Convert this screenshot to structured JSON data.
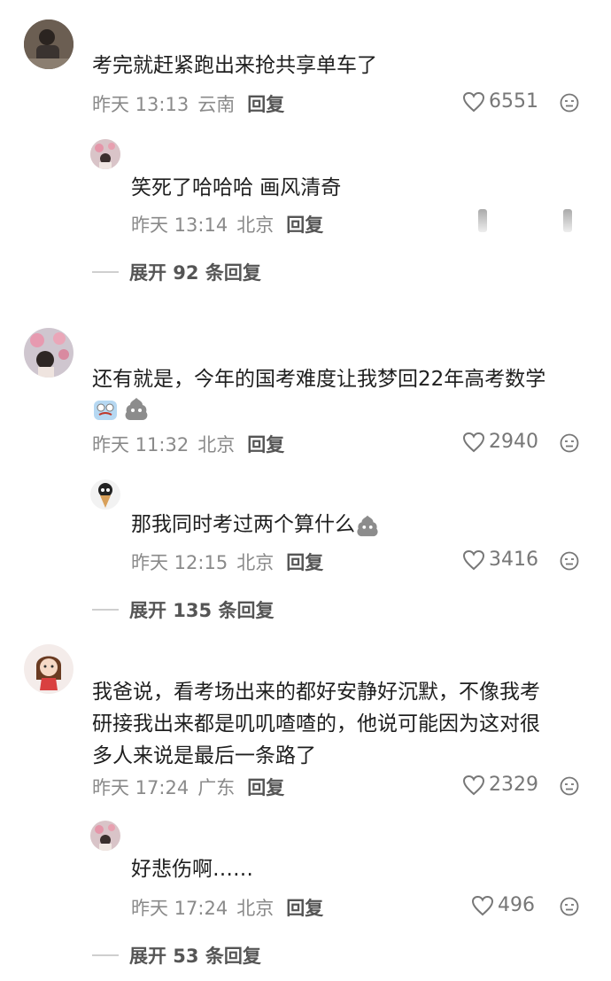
{
  "comments": [
    {
      "text": "考完就赶紧跑出来抢共享单车了",
      "time": "昨天 13:13",
      "location": "云南",
      "reply_label": "回复",
      "likes": "6551",
      "reply": {
        "text": "笑死了哈哈哈 画风清奇",
        "time": "昨天 13:14",
        "location": "北京",
        "reply_label": "回复",
        "likes": ""
      },
      "expand": "展开 92 条回复"
    },
    {
      "text": "还有就是，今年的国考难度让我梦回22年高考数学",
      "time": "昨天 11:32",
      "location": "北京",
      "reply_label": "回复",
      "likes": "2940",
      "reply": {
        "text": "那我同时考过两个算什么",
        "time": "昨天 12:15",
        "location": "北京",
        "reply_label": "回复",
        "likes": "3416"
      },
      "expand": "展开 135 条回复"
    },
    {
      "text_lines": [
        "我爸说，看考场出来的都好安静好沉默，不像我考",
        "研接我出来都是叽叽喳喳的，他说可能因为这对很",
        "多人来说是最后一条路了"
      ],
      "time": "昨天 17:24",
      "location": "广东",
      "reply_label": "回复",
      "likes": "2329",
      "reply": {
        "text": "好悲伤啊……",
        "time": "昨天 17:24",
        "location": "北京",
        "reply_label": "回复",
        "likes": "496"
      },
      "expand": "展开 53 条回复"
    }
  ],
  "icons": {
    "like": "heart-outline-icon",
    "dislike": "dislike-face-icon"
  },
  "colors": {
    "meta": "#8a8a8a",
    "reply": "#555555"
  }
}
